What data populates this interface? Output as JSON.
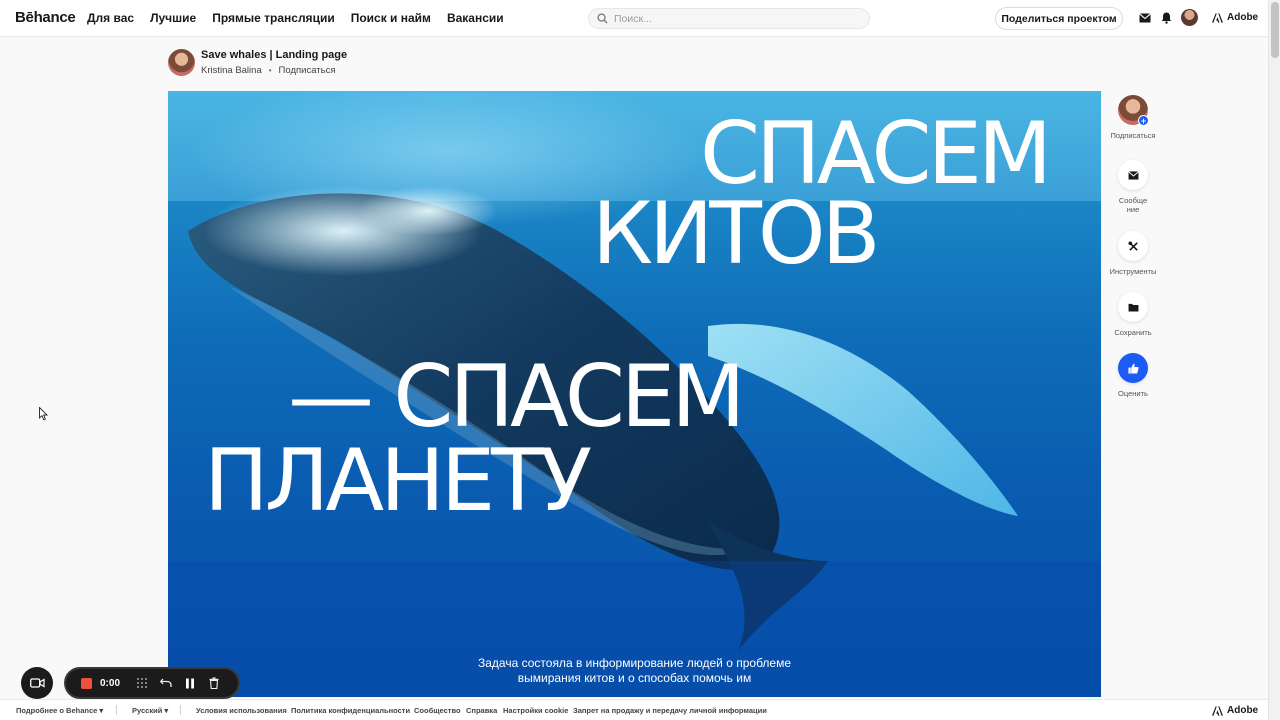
{
  "header": {
    "logo": "Bēhance",
    "nav": [
      "Для вас",
      "Лучшие",
      "Прямые трансляции",
      "Поиск и найм",
      "Вакансии"
    ],
    "search_placeholder": "Поиск...",
    "share_button": "Поделиться проектом",
    "icons": [
      "mail-icon",
      "bell-icon",
      "avatar",
      "adobe-icon"
    ],
    "adobe_label": "Adobe"
  },
  "project": {
    "title": "Save whales | Landing page",
    "author": "Kristina Balina",
    "subscribe": "Подписаться"
  },
  "hero": {
    "line1": "СПАСЕМ",
    "line2": "КИТОВ",
    "line3": "— СПАСЕМ",
    "line4": "ПЛАНЕТУ",
    "caption_line1": "Задача состояла в информирование людей о проблеме",
    "caption_line2": "вымирания китов и о способах помочь им"
  },
  "rail": {
    "subscribe": "Подписаться",
    "message_line1": "Сообще",
    "message_line2": "ние",
    "tools": "Инструменты",
    "save": "Сохранить",
    "appreciate": "Оценить",
    "accent": "#1c5cf5"
  },
  "recorder": {
    "time": "0:00",
    "stop_color": "#f0513b"
  },
  "footer": {
    "more": "Подробнее о Behance ▾",
    "language": "Русский ▾",
    "links": [
      "Условия использования",
      "Политика конфиденциальности",
      "Сообщество",
      "Справка",
      "Настройки cookie",
      "Запрет на продажу и передачу личной информации"
    ],
    "adobe_label": "Adobe"
  }
}
